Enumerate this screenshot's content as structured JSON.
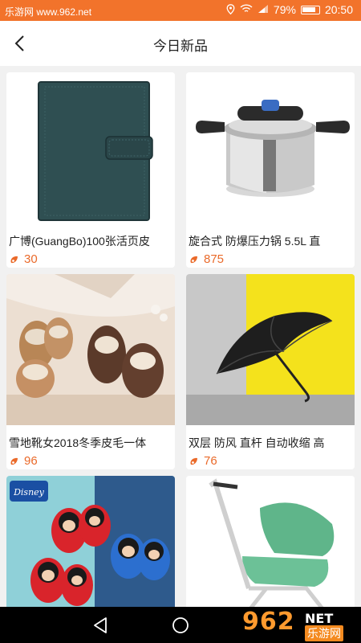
{
  "status_bar": {
    "watermark": "乐游网 www.962.net",
    "battery": "79%",
    "time": "20:50"
  },
  "header": {
    "title": "今日新品"
  },
  "products": [
    {
      "name": "广博(GuangBo)100张活页皮",
      "price": "30"
    },
    {
      "name": "旋合式  防爆压力锅 5.5L 直",
      "price": "875"
    },
    {
      "name": "雪地靴女2018冬季皮毛一体",
      "price": "96"
    },
    {
      "name": "双层 防风 直杆 自动收缩 高",
      "price": "76"
    },
    {
      "name": "",
      "price": ""
    },
    {
      "name": "",
      "price": ""
    }
  ],
  "disney_logo_text": "Disney",
  "watermark_logo": {
    "big": "962",
    "net": "NET",
    "cn": "乐游网"
  },
  "colors": {
    "accent": "#f2732b",
    "price": "#ea6a2a"
  }
}
